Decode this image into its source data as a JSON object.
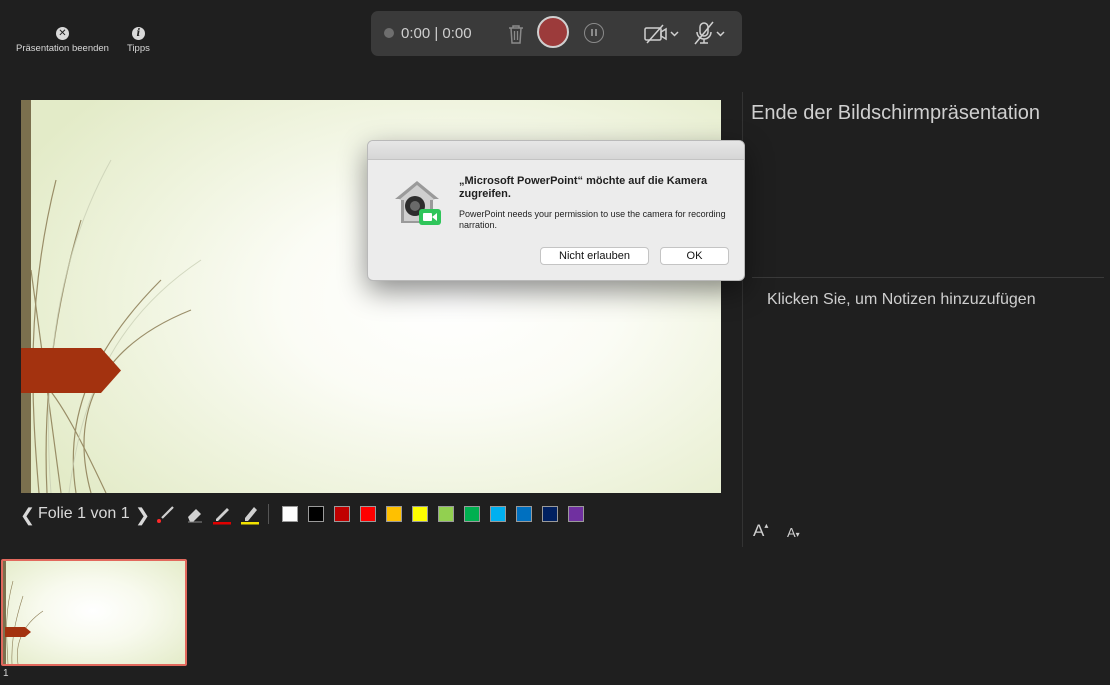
{
  "toolbar": {
    "end_show": "Präsentation beenden",
    "tips": "Tipps"
  },
  "recording": {
    "timer": "0:00 | 0:00"
  },
  "next_slide": {
    "title": "Ende der Bildschirmpräsentation"
  },
  "notes": {
    "placeholder": "Klicken Sie, um Notizen hinzuzufügen"
  },
  "font": {
    "increase": "A",
    "decrease": "A"
  },
  "slide_nav": {
    "label": "Folie 1 von 1"
  },
  "pen_colors": [
    "#ffffff",
    "#000000",
    "#c00000",
    "#ff0000",
    "#ffc000",
    "#ffff00",
    "#92d050",
    "#00b050",
    "#00b0f0",
    "#0070c0",
    "#002060",
    "#7030a0"
  ],
  "thumbnails": [
    {
      "number": "1"
    }
  ],
  "dialog": {
    "heading": "„Microsoft PowerPoint“ möchte auf die Kamera zugreifen.",
    "message": "PowerPoint needs your permission to use the camera for recording narration.",
    "deny_label": "Nicht erlauben",
    "ok_label": "OK"
  }
}
